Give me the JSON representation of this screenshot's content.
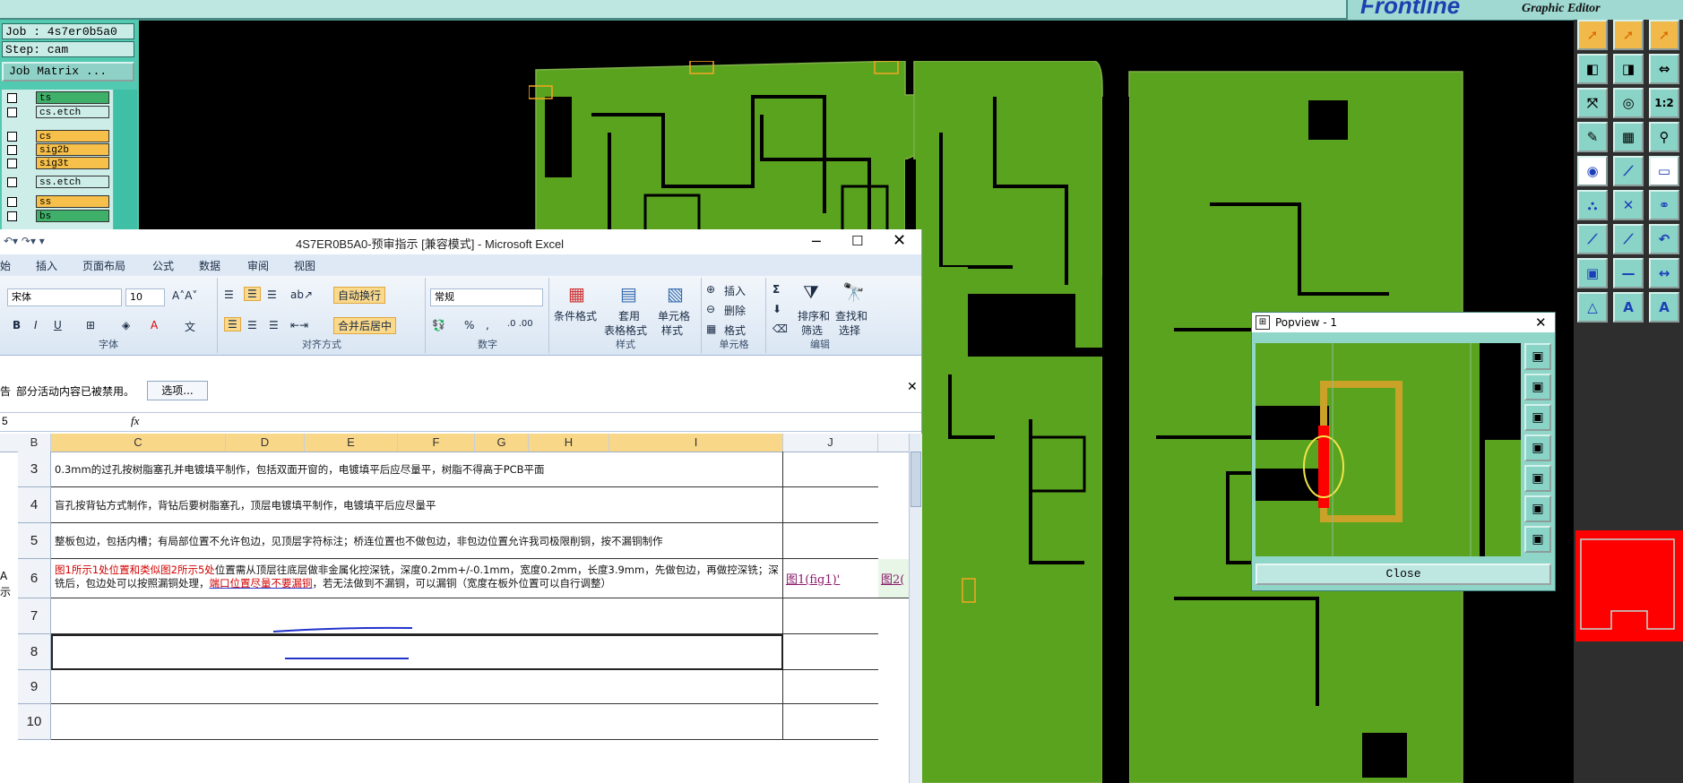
{
  "cam": {
    "job_label": "Job : 4s7er0b5a0",
    "step_label": "Step: cam",
    "job_matrix_button": "Job Matrix ...",
    "layers": [
      {
        "name": "ts",
        "color": "#3fb06a"
      },
      {
        "name": "cs.etch",
        "color": "#cdeee8"
      },
      {
        "name": "cs",
        "color": "#f7c04a"
      },
      {
        "name": "sig2b",
        "color": "#f7c04a"
      },
      {
        "name": "sig3t",
        "color": "#f7c04a"
      },
      {
        "name": "ss.etch",
        "color": "#cdeee8"
      },
      {
        "name": "ss",
        "color": "#f7c04a"
      },
      {
        "name": "bs",
        "color": "#3fb06a"
      }
    ],
    "brand": "Frontline",
    "brand_subtitle": "Graphic Editor",
    "toolbar_1to2_label": "1:2"
  },
  "excel": {
    "title": "4S7ER0B5A0-预审指示 [兼容模式] - Microsoft Excel",
    "tabs": [
      "始",
      "插入",
      "页面布局",
      "公式",
      "数据",
      "审阅",
      "视图"
    ],
    "font_name": "宋体",
    "font_size": "10",
    "wrap_text": "自动换行",
    "merge_center": "合并后居中",
    "number_format": "常规",
    "styles_buttons": {
      "conditional": "条件格式",
      "table_1": "套用",
      "table_2": "表格格式",
      "cell_style_1": "单元格",
      "cell_style_2": "样式"
    },
    "cells_buttons": {
      "insert": "插入",
      "delete": "删除",
      "format": "格式"
    },
    "edit_buttons": {
      "sort_1": "排序和",
      "sort_2": "筛选",
      "find_1": "查找和",
      "find_2": "选择"
    },
    "group_labels": {
      "font": "字体",
      "align": "对齐方式",
      "number": "数字",
      "styles": "样式",
      "cells": "单元格",
      "edit": "编辑"
    },
    "message_bar_prefix": "告",
    "message_bar_text": "部分活动内容已被禁用。",
    "options_button": "选项...",
    "name_box": "5",
    "fx": "fx",
    "columns": [
      "B",
      "C",
      "D",
      "E",
      "F",
      "G",
      "H",
      "I",
      "J"
    ],
    "row_side_label_1": "A",
    "row_side_label_2": "示",
    "rows": [
      {
        "num": "3",
        "text": "0.3mm的过孔按树脂塞孔并电镀填平制作，包括双面开窗的，电镀填平后应尽量平，树脂不得高于PCB平面"
      },
      {
        "num": "4",
        "text": "盲孔按背钻方式制作，背钻后要树脂塞孔，顶层电镀填平制作，电镀填平后应尽量平"
      },
      {
        "num": "5",
        "text": "整板包边，包括内槽；有局部位置不允许包边，见顶层字符标注；桥连位置也不做包边，非包边位置允许我司极限削铜，按不漏铜制作"
      },
      {
        "num": "6",
        "text_red_1": "图1所示1处位置和类似图2所示5处",
        "text_black_1": "位置需从顶层往底层做非金属化控深铣，深度0.2mm+/-0.1mm，宽度0.2mm，长度3.9mm，先做包边，再做控深铣；深铣后，包边处可以按照漏铜处理，",
        "text_red_2": "端口位置尽量不要漏铜",
        "text_black_2": "，若无法做到不漏铜，可以漏铜（宽度在板外位置可以自行调整）",
        "link_1": "图1(fig1)'",
        "link_2": "图2("
      },
      {
        "num": "7",
        "text": ""
      },
      {
        "num": "8",
        "text": ""
      },
      {
        "num": "9",
        "text": ""
      },
      {
        "num": "10",
        "text": ""
      }
    ]
  },
  "popview": {
    "title": "Popview - 1",
    "close_button": "Close"
  }
}
